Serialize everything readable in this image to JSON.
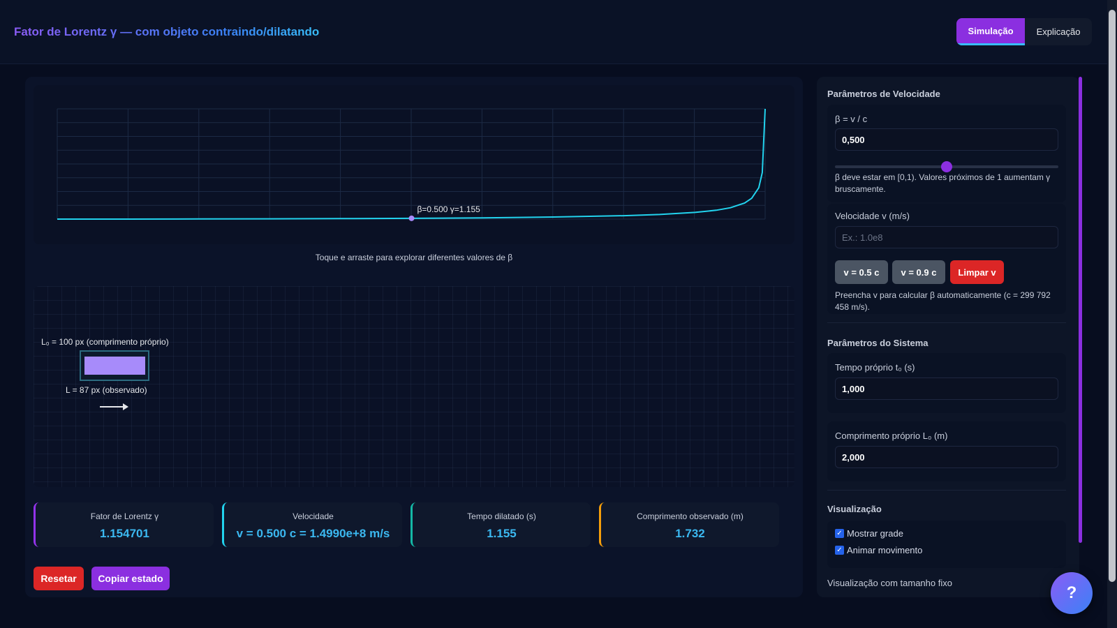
{
  "header": {
    "title": "Fator de Lorentz γ — com objeto contraindo/dilatando",
    "tabs": [
      {
        "label": "Simulação",
        "active": true
      },
      {
        "label": "Explicação",
        "active": false
      }
    ]
  },
  "chart": {
    "hint": "Toque e arraste para explorar diferentes valores de β"
  },
  "chart_data": {
    "type": "line",
    "title": "",
    "xlabel": "",
    "ylabel": "",
    "grid": true,
    "xlim": [
      0,
      0.999
    ],
    "curve": "gamma = 1 / sqrt(1 - beta^2)",
    "series": [
      {
        "x": [
          0,
          0.1,
          0.2,
          0.3,
          0.4,
          0.5,
          0.6,
          0.7,
          0.8,
          0.85,
          0.9,
          0.93,
          0.95,
          0.97,
          0.98,
          0.99,
          0.995,
          0.999
        ],
        "values": [
          1.0,
          1.005,
          1.021,
          1.048,
          1.091,
          1.155,
          1.25,
          1.4,
          1.667,
          1.898,
          2.294,
          2.72,
          3.203,
          4.113,
          5.025,
          7.089,
          10.013,
          22.366
        ]
      }
    ],
    "marker": {
      "x": 0.5,
      "y": 1.155,
      "label": "β=0.500 γ=1.155"
    },
    "color": "#22d3ee"
  },
  "visualization": {
    "proper_label": "L₀ = 100 px (comprimento próprio)",
    "observed_label": "L = 87 px (observado)",
    "object_color": "#a78bfa"
  },
  "stats": [
    {
      "label": "Fator de Lorentz γ",
      "value": "1.154701",
      "accent": "#9333ea"
    },
    {
      "label": "Velocidade",
      "value": "v = 0.500 c = 1.4990e+8 m/s",
      "accent": "#22d3ee"
    },
    {
      "label": "Tempo dilatado (s)",
      "value": "1.155",
      "accent": "#14b8a6"
    },
    {
      "label": "Comprimento observado (m)",
      "value": "1.732",
      "accent": "#f59e0b"
    }
  ],
  "actions": {
    "reset_label": "Resetar",
    "copy_label": "Copiar estado"
  },
  "sidebar": {
    "velocity_section": {
      "title": "Parâmetros de Velocidade",
      "beta_label": "β = v / c",
      "beta_value": "0,500",
      "beta_slider": 0.5,
      "beta_help": "β deve estar em [0,1). Valores próximos de 1 aumentam γ bruscamente.",
      "v_label": "Velocidade v (m/s)",
      "v_placeholder": "Ex.: 1.0e8",
      "presets": [
        "v = 0.5 c",
        "v = 0.9 c"
      ],
      "clear_label": "Limpar v",
      "v_help": "Preencha v para calcular β automaticamente (c = 299 792 458 m/s)."
    },
    "system_section": {
      "title": "Parâmetros do Sistema",
      "time_label": "Tempo próprio t₀ (s)",
      "time_value": "1,000",
      "length_label": "Comprimento próprio L₀ (m)",
      "length_value": "2,000"
    },
    "visual_section": {
      "title": "Visualização",
      "show_grid": "Mostrar grade",
      "animate": "Animar movimento",
      "fixed_size": "Visualização com tamanho fixo"
    }
  },
  "help_button": "?",
  "colors": {
    "accent_purple": "#8b2fe0",
    "danger_red": "#dc2626",
    "gray_button": "#4b5563",
    "curve_cyan": "#22d3ee"
  }
}
